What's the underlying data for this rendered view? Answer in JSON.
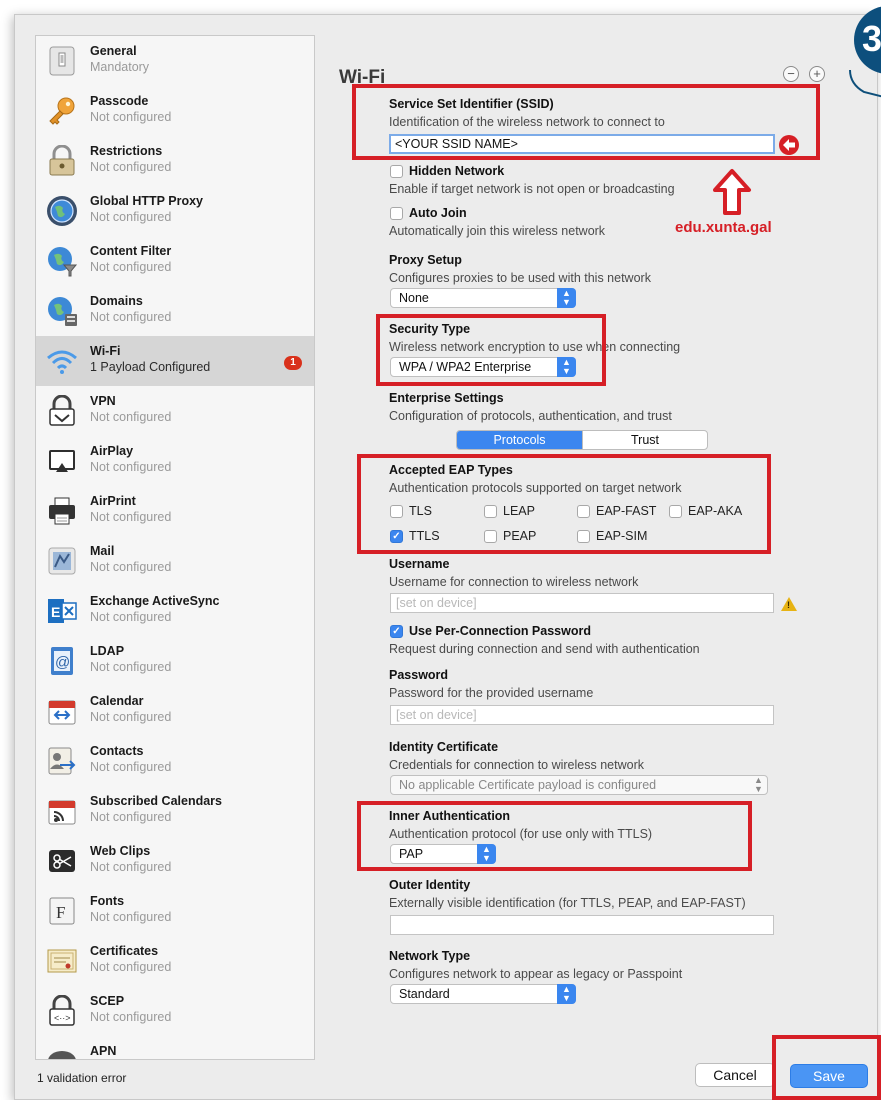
{
  "sidebar": {
    "items": [
      {
        "title": "General",
        "subtitle": "Mandatory",
        "icon": "general-icon"
      },
      {
        "title": "Passcode",
        "subtitle": "Not configured",
        "icon": "key-icon"
      },
      {
        "title": "Restrictions",
        "subtitle": "Not configured",
        "icon": "lock-icon"
      },
      {
        "title": "Global HTTP Proxy",
        "subtitle": "Not configured",
        "icon": "globe-icon"
      },
      {
        "title": "Content Filter",
        "subtitle": "Not configured",
        "icon": "globe-filter-icon"
      },
      {
        "title": "Domains",
        "subtitle": "Not configured",
        "icon": "globe-domain-icon"
      },
      {
        "title": "Wi-Fi",
        "subtitle": "1 Payload Configured",
        "icon": "wifi-icon",
        "badge": "1"
      },
      {
        "title": "VPN",
        "subtitle": "Not configured",
        "icon": "vpn-lock-icon"
      },
      {
        "title": "AirPlay",
        "subtitle": "Not configured",
        "icon": "airplay-icon"
      },
      {
        "title": "AirPrint",
        "subtitle": "Not configured",
        "icon": "printer-icon"
      },
      {
        "title": "Mail",
        "subtitle": "Not configured",
        "icon": "mail-icon"
      },
      {
        "title": "Exchange ActiveSync",
        "subtitle": "Not configured",
        "icon": "exchange-icon"
      },
      {
        "title": "LDAP",
        "subtitle": "Not configured",
        "icon": "ldap-icon"
      },
      {
        "title": "Calendar",
        "subtitle": "Not configured",
        "icon": "calendar-icon"
      },
      {
        "title": "Contacts",
        "subtitle": "Not configured",
        "icon": "contacts-icon"
      },
      {
        "title": "Subscribed Calendars",
        "subtitle": "Not configured",
        "icon": "subscribed-calendar-icon"
      },
      {
        "title": "Web Clips",
        "subtitle": "Not configured",
        "icon": "webclip-icon"
      },
      {
        "title": "Fonts",
        "subtitle": "Not configured",
        "icon": "font-icon"
      },
      {
        "title": "Certificates",
        "subtitle": "Not configured",
        "icon": "certificate-icon"
      },
      {
        "title": "SCEP",
        "subtitle": "Not configured",
        "icon": "scep-icon"
      },
      {
        "title": "APN",
        "subtitle": "",
        "icon": "apn-icon"
      }
    ]
  },
  "main": {
    "title": "Wi-Fi",
    "remove_btn": "−",
    "add_btn": "+",
    "ssid": {
      "label": "Service Set Identifier (SSID)",
      "desc": "Identification of the wireless network to connect to",
      "value": "<YOUR SSID NAME>"
    },
    "hidden_network": {
      "label": "Hidden Network",
      "desc": "Enable if target network is not open or broadcasting",
      "checked": false
    },
    "auto_join": {
      "label": "Auto Join",
      "desc": "Automatically join this wireless network",
      "checked": false
    },
    "proxy": {
      "label": "Proxy Setup",
      "desc": "Configures proxies to be used with this network",
      "value": "None"
    },
    "security": {
      "label": "Security Type",
      "desc": "Wireless network encryption to use when connecting",
      "value": "WPA / WPA2 Enterprise"
    },
    "enterprise": {
      "label": "Enterprise Settings",
      "desc": "Configuration of protocols, authentication, and trust",
      "tabs": [
        "Protocols",
        "Trust"
      ]
    },
    "eap": {
      "label": "Accepted EAP Types",
      "desc": "Authentication protocols supported on target network",
      "types": [
        {
          "label": "TLS",
          "checked": false
        },
        {
          "label": "LEAP",
          "checked": false
        },
        {
          "label": "EAP-FAST",
          "checked": false
        },
        {
          "label": "EAP-AKA",
          "checked": false
        },
        {
          "label": "TTLS",
          "checked": true
        },
        {
          "label": "PEAP",
          "checked": false
        },
        {
          "label": "EAP-SIM",
          "checked": false
        }
      ]
    },
    "username": {
      "label": "Username",
      "desc": "Username for connection to wireless network",
      "placeholder": "[set on device]"
    },
    "per_connection_password": {
      "label": "Use Per-Connection Password",
      "desc": "Request during connection and send with authentication",
      "checked": true
    },
    "password": {
      "label": "Password",
      "desc": "Password for the provided username",
      "placeholder": "[set on device]"
    },
    "identity_cert": {
      "label": "Identity Certificate",
      "desc": "Credentials for connection to wireless network",
      "value": "No applicable Certificate payload is configured"
    },
    "inner_auth": {
      "label": "Inner Authentication",
      "desc": "Authentication protocol (for use only with TTLS)",
      "value": "PAP"
    },
    "outer_identity": {
      "label": "Outer Identity",
      "desc": "Externally visible identification (for TTLS, PEAP, and EAP-FAST)",
      "value": ""
    },
    "network_type": {
      "label": "Network Type",
      "desc": "Configures network to appear as legacy or Passpoint",
      "value": "Standard"
    }
  },
  "footer": {
    "status": "1 validation error",
    "cancel": "Cancel",
    "save": "Save"
  },
  "annotations": {
    "step_number": "3",
    "domain_hint": "edu.xunta.gal",
    "highlight_color": "#d61f26"
  },
  "colors": {
    "accent": "#3b86ef",
    "badge": "#d9311b",
    "warning": "#e7b313"
  }
}
